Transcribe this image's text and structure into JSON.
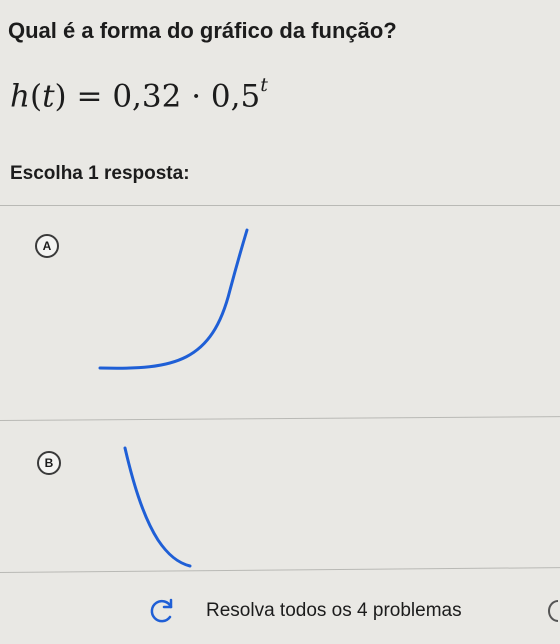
{
  "question": {
    "title": "Qual é a forma do gráfico da função?"
  },
  "formula": {
    "lhs": "h",
    "var": "t",
    "rhs": "= 0,32 · 0,5",
    "exponent": "t"
  },
  "instruction": "Escolha 1 resposta:",
  "options": [
    {
      "letter": "A",
      "curve": "increasing"
    },
    {
      "letter": "B",
      "curve": "decreasing"
    }
  ],
  "footer": {
    "submit_label": "Resolva todos os 4 problemas",
    "icon": "refresh-icon"
  },
  "colors": {
    "curve": "#1f5fd6",
    "background": "#e9e8e4"
  }
}
